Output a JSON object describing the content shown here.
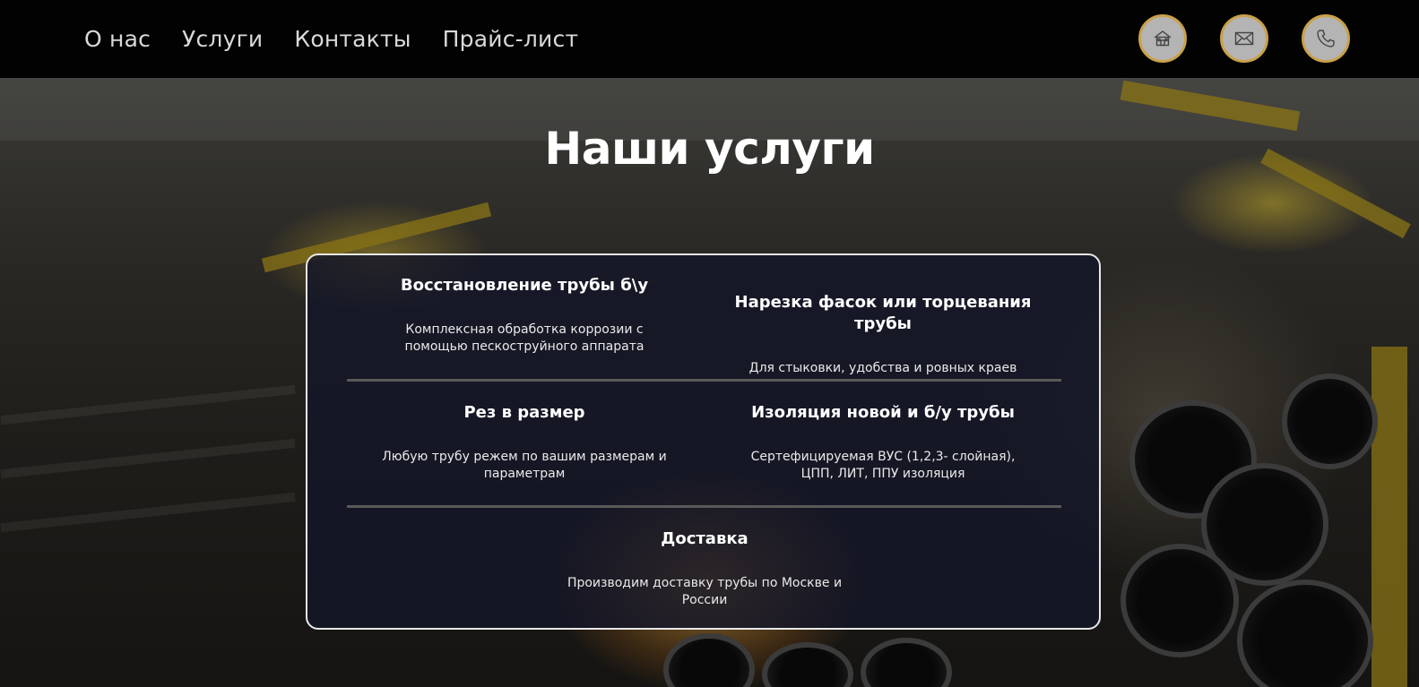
{
  "nav": {
    "items": [
      "О нас",
      "Услуги",
      "Контакты",
      "Прайс-лист"
    ]
  },
  "header_icons": [
    "home-icon",
    "mail-icon",
    "phone-icon"
  ],
  "colors": {
    "icon_border": "#c9a14a",
    "icon_fill": "#b4b4b4",
    "card_border": "#e8e8e8"
  },
  "services": {
    "title": "Наши услуги",
    "items": [
      {
        "title": "Восстановление трубы б\\у",
        "description": "Комплексная обработка коррозии с помощью пескоструйного аппарата"
      },
      {
        "title": "Нарезка фасок или торцевания трубы",
        "description": "Для стыковки, удобства и ровных краев"
      },
      {
        "title": "Рез в размер",
        "description": "Любую трубу режем по вашим размерам и параметрам"
      },
      {
        "title": "Изоляция новой и б/у трубы",
        "description": "Сертефицируемая ВУС (1,2,3- слойная), ЦПП, ЛИТ, ППУ изоляция"
      },
      {
        "title": "Доставка",
        "description": "Производим доставку трубы по Москве и России"
      }
    ]
  }
}
